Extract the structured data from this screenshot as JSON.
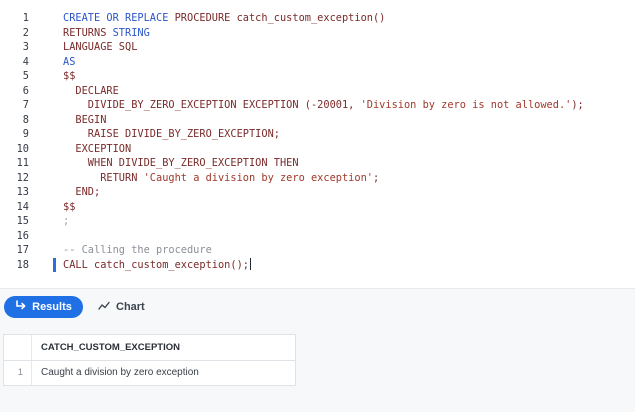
{
  "editor": {
    "lines": [
      {
        "num": "1",
        "tokens": [
          {
            "t": "CREATE OR REPLACE",
            "c": "kw"
          },
          {
            "t": " PROCEDURE catch_custom_exception()",
            "c": "dk"
          }
        ]
      },
      {
        "num": "2",
        "tokens": [
          {
            "t": "RETURNS ",
            "c": "dk"
          },
          {
            "t": "STRING",
            "c": "kw"
          }
        ]
      },
      {
        "num": "3",
        "tokens": [
          {
            "t": "LANGUAGE SQL",
            "c": "dk"
          }
        ]
      },
      {
        "num": "4",
        "tokens": [
          {
            "t": "AS",
            "c": "kw"
          }
        ]
      },
      {
        "num": "5",
        "tokens": [
          {
            "t": "$$",
            "c": "dk"
          }
        ]
      },
      {
        "num": "6",
        "tokens": [
          {
            "t": "  DECLARE",
            "c": "dk"
          }
        ]
      },
      {
        "num": "7",
        "tokens": [
          {
            "t": "    DIVIDE_BY_ZERO_EXCEPTION EXCEPTION (-20001, ",
            "c": "dk"
          },
          {
            "t": "'Division by zero is not allowed.'",
            "c": "str"
          },
          {
            "t": ");",
            "c": "dk"
          }
        ]
      },
      {
        "num": "8",
        "tokens": [
          {
            "t": "  BEGIN",
            "c": "dk"
          }
        ]
      },
      {
        "num": "9",
        "tokens": [
          {
            "t": "    RAISE DIVIDE_BY_ZERO_EXCEPTION;",
            "c": "dk"
          }
        ]
      },
      {
        "num": "10",
        "tokens": [
          {
            "t": "  EXCEPTION",
            "c": "dk"
          }
        ]
      },
      {
        "num": "11",
        "tokens": [
          {
            "t": "    WHEN DIVIDE_BY_ZERO_EXCEPTION THEN",
            "c": "dk"
          }
        ]
      },
      {
        "num": "12",
        "tokens": [
          {
            "t": "      RETURN ",
            "c": "dk"
          },
          {
            "t": "'Caught a division by zero exception'",
            "c": "str"
          },
          {
            "t": ";",
            "c": "dk"
          }
        ]
      },
      {
        "num": "13",
        "tokens": [
          {
            "t": "  END;",
            "c": "dk"
          }
        ]
      },
      {
        "num": "14",
        "tokens": [
          {
            "t": "$$",
            "c": "dk"
          }
        ]
      },
      {
        "num": "15",
        "tokens": [
          {
            "t": ";",
            "c": "semi"
          }
        ]
      },
      {
        "num": "16",
        "tokens": []
      },
      {
        "num": "17",
        "tokens": [
          {
            "t": "-- Calling the procedure",
            "c": "cm"
          }
        ]
      },
      {
        "num": "18",
        "tokens": [
          {
            "t": "CALL catch_custom_exception();",
            "c": "dk"
          }
        ],
        "active": true
      }
    ]
  },
  "tabs": {
    "results_label": "Results",
    "results_icon": "return-arrow-icon",
    "chart_label": "Chart",
    "chart_icon": "line-chart-icon"
  },
  "results": {
    "columns": [
      "CATCH_CUSTOM_EXCEPTION"
    ],
    "rows": [
      {
        "num": "1",
        "cells": [
          "Caught a division by zero exception"
        ]
      }
    ]
  },
  "colors": {
    "accent": "#1f6fe5",
    "keyword": "#2b56c8",
    "string": "#a1392c",
    "comment": "#8c9099"
  }
}
